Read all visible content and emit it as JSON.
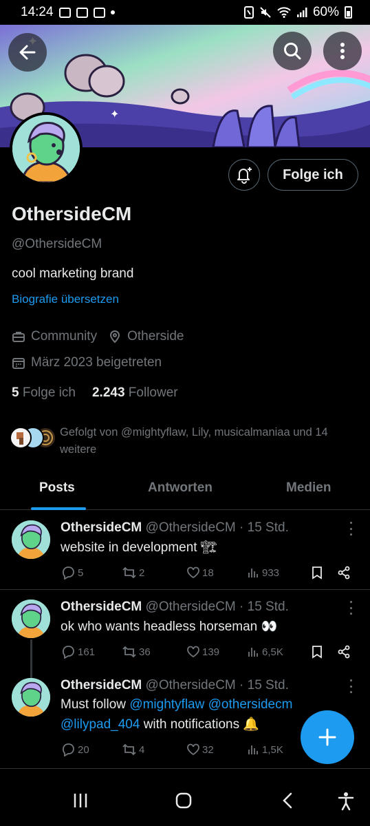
{
  "status_bar": {
    "time": "14:24",
    "battery": "60%"
  },
  "profile": {
    "name": "OthersideCM",
    "handle": "@OthersideCM",
    "bio": "cool marketing brand",
    "translate_link": "Biografie übersetzen",
    "category": "Community",
    "location": "Otherside",
    "joined": "März 2023 beigetreten",
    "following_count": "5",
    "following_label": "Folge ich",
    "followers_count": "2.243",
    "followers_label": "Follower",
    "follow_button": "Folge ich",
    "followed_by": "Gefolgt von @mightyflaw, Lily, musicalmaniaa und 14 weitere"
  },
  "tabs": [
    {
      "label": "Posts",
      "active": true
    },
    {
      "label": "Antworten",
      "active": false
    },
    {
      "label": "Medien",
      "active": false
    }
  ],
  "posts": [
    {
      "name": "OthersideCM",
      "handle": "@OthersideCM",
      "sep": "·",
      "time": "15 Std.",
      "text": "website in development 🏗",
      "replies": "5",
      "reposts": "2",
      "likes": "18",
      "views": "933"
    },
    {
      "name": "OthersideCM",
      "handle": "@OthersideCM",
      "sep": "·",
      "time": "15 Std.",
      "text": "ok who wants headless horseman 👀",
      "replies": "161",
      "reposts": "36",
      "likes": "139",
      "views": "6,5K"
    },
    {
      "name": "OthersideCM",
      "handle": "@OthersideCM",
      "sep": "·",
      "time": "15 Std.",
      "text_prefix": "Must follow ",
      "mention1": "@mightyflaw",
      "mention2": "@othersidecm",
      "mention3": "@lilypad_404",
      "text_suffix": " with notifications 🔔",
      "replies": "20",
      "reposts": "4",
      "likes": "32",
      "views": "1,5K"
    }
  ],
  "colors": {
    "accent": "#1d9bf0",
    "background": "#000000",
    "text": "#e7e9ea",
    "muted": "#71767b",
    "border": "#2f3336"
  }
}
